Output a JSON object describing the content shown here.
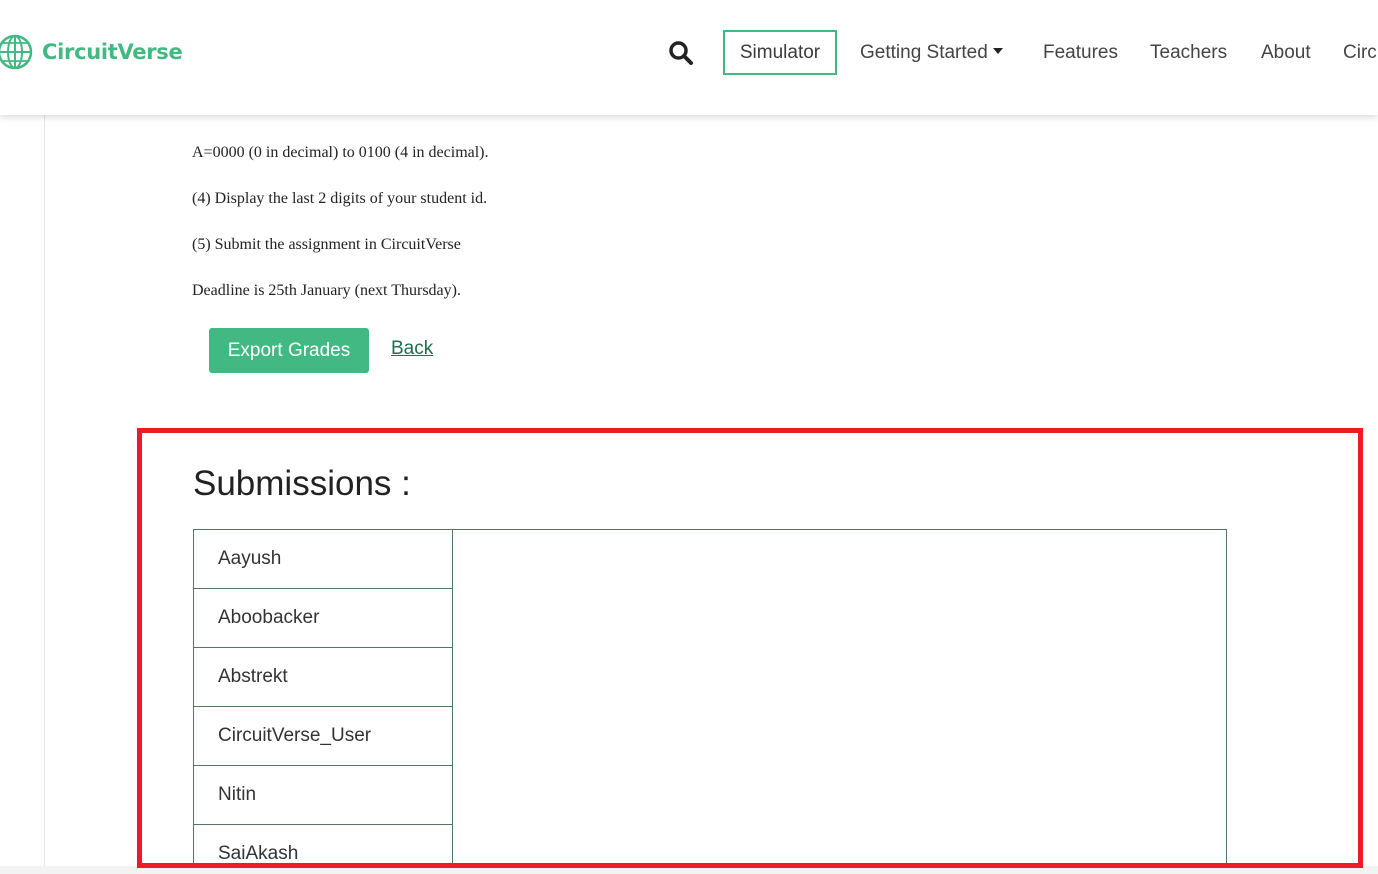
{
  "brand": {
    "name": "CircuitVerse",
    "accent_color": "#42b983"
  },
  "nav": {
    "search_icon": "search-icon",
    "simulator": "Simulator",
    "getting_started": "Getting Started",
    "features": "Features",
    "teachers": "Teachers",
    "about": "About",
    "truncated": "Circ"
  },
  "assignment": {
    "lines": [
      "A=0000 (0 in decimal) to 0100 (4 in decimal).",
      "(4) Display the last 2 digits of your student id.",
      "(5) Submit the assignment in CircuitVerse",
      "Deadline is 25th January (next Thursday)."
    ]
  },
  "actions": {
    "export": "Export Grades",
    "back": "Back"
  },
  "submissions": {
    "title": "Submissions :",
    "users": [
      "Aayush",
      "Aboobacker",
      "Abstrekt",
      "CircuitVerse_User",
      "Nitin",
      "SaiAkash"
    ]
  },
  "highlight_color": "#ee1b24"
}
